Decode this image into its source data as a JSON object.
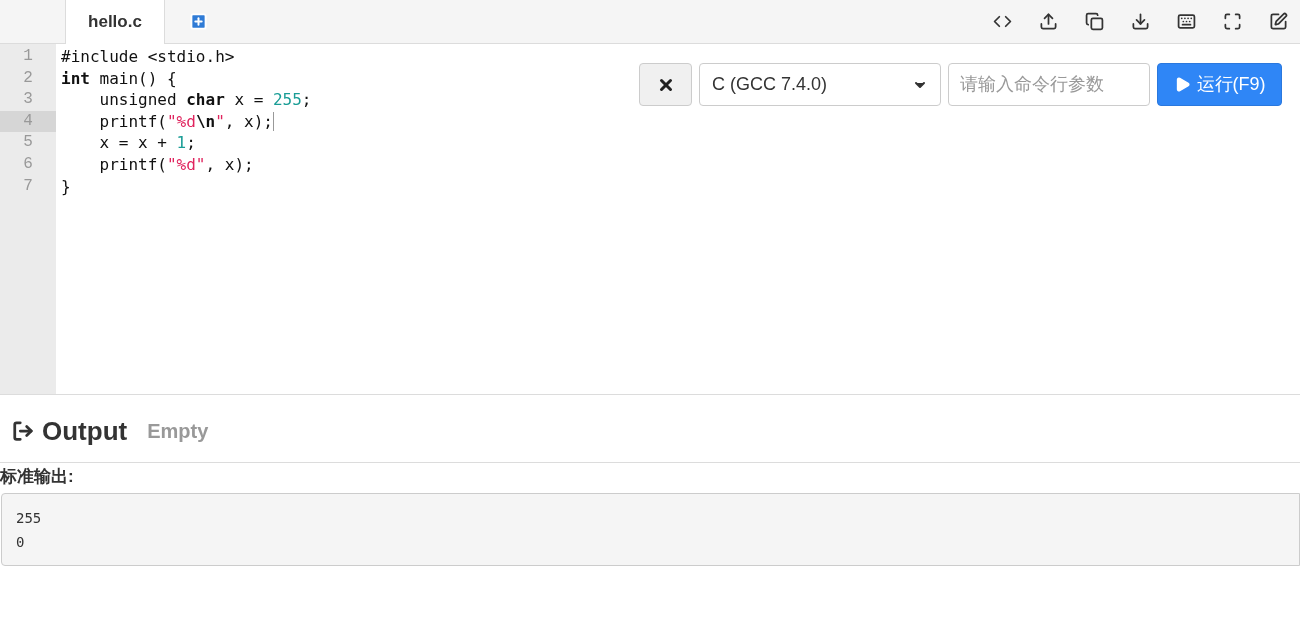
{
  "tabs": [
    {
      "label": "hello.c",
      "selected": true
    }
  ],
  "code_lines": [
    {
      "number": "1",
      "active": false,
      "tokens": [
        {
          "kind": "plain",
          "text": "#include <stdio.h>"
        }
      ]
    },
    {
      "number": "2",
      "active": false,
      "tokens": [
        {
          "kind": "keyword",
          "text": "int"
        },
        {
          "kind": "plain",
          "text": " main() {"
        }
      ]
    },
    {
      "number": "3",
      "active": false,
      "tokens": [
        {
          "kind": "plain",
          "text": "    unsigned "
        },
        {
          "kind": "keyword",
          "text": "char"
        },
        {
          "kind": "plain",
          "text": " x = "
        },
        {
          "kind": "number",
          "text": "255"
        },
        {
          "kind": "plain",
          "text": ";"
        }
      ]
    },
    {
      "number": "4",
      "active": true,
      "tokens": [
        {
          "kind": "plain",
          "text": "    printf("
        },
        {
          "kind": "string",
          "text": "\"%d"
        },
        {
          "kind": "escape",
          "text": "\\n"
        },
        {
          "kind": "string",
          "text": "\""
        },
        {
          "kind": "plain",
          "text": ", x);"
        }
      ]
    },
    {
      "number": "5",
      "active": false,
      "tokens": [
        {
          "kind": "plain",
          "text": "    x = x + "
        },
        {
          "kind": "number",
          "text": "1"
        },
        {
          "kind": "plain",
          "text": ";"
        }
      ]
    },
    {
      "number": "6",
      "active": false,
      "tokens": [
        {
          "kind": "plain",
          "text": "    printf("
        },
        {
          "kind": "string",
          "text": "\"%d\""
        },
        {
          "kind": "plain",
          "text": ", x);"
        }
      ]
    },
    {
      "number": "7",
      "active": false,
      "tokens": [
        {
          "kind": "plain",
          "text": "}"
        }
      ]
    }
  ],
  "run_bar": {
    "language": "C (GCC 7.4.0)",
    "args_placeholder": "请输入命令行参数",
    "run_button": "运行(F9)"
  },
  "output": {
    "title": "Output",
    "status": "Empty",
    "stdout_label": "标准输出:",
    "stdout_lines": [
      "255",
      "0"
    ]
  }
}
